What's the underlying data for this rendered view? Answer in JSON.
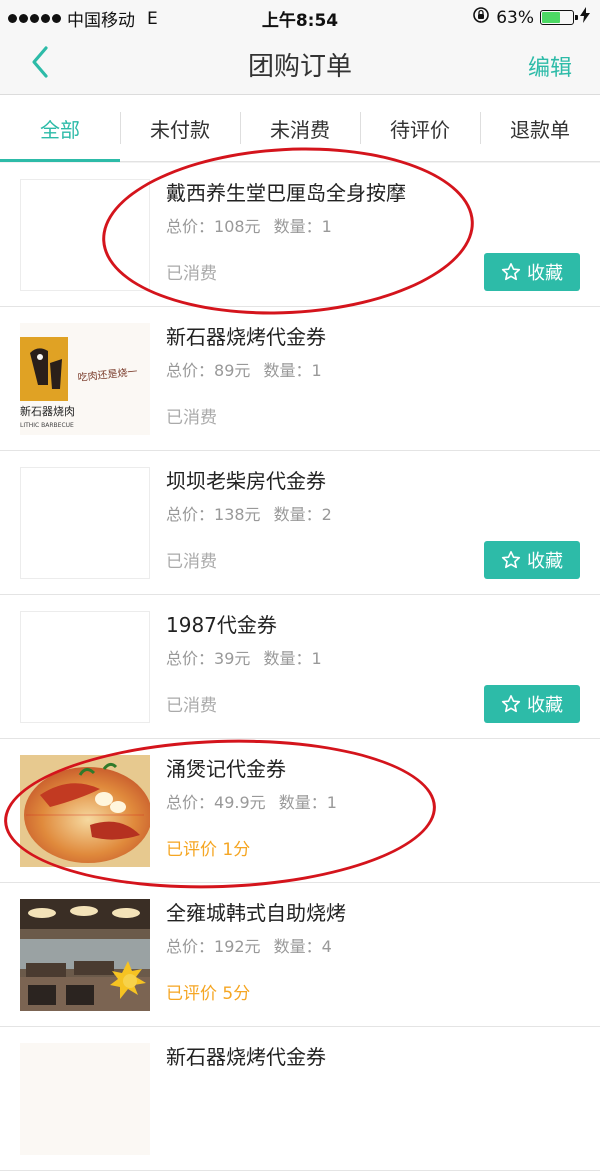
{
  "statusbar": {
    "carrier": "中国移动",
    "network": "E",
    "time": "上午8:54",
    "battery_text": "63%",
    "battery_level": 0.63
  },
  "nav": {
    "back_icon": "chevron-left-icon",
    "title": "团购订单",
    "edit_label": "编辑"
  },
  "tabs": [
    {
      "label": "全部",
      "active": true
    },
    {
      "label": "未付款",
      "active": false
    },
    {
      "label": "未消费",
      "active": false
    },
    {
      "label": "待评价",
      "active": false
    },
    {
      "label": "退款单",
      "active": false
    }
  ],
  "orders": [
    {
      "title": "戴西养生堂巴厘岛全身按摩",
      "price_label": "总价：",
      "price": "108元",
      "qty_label": "数量：",
      "qty": "1",
      "status": "已消费",
      "fav_label": "收藏",
      "thumb": "blank"
    },
    {
      "title": "新石器烧烤代金券",
      "price_label": "总价：",
      "price": "89元",
      "qty_label": "数量：",
      "qty": "1",
      "status": "已消费",
      "thumb": "logo",
      "logo_text": "新石器烧肉",
      "logo_subtext": "LITHIC BARBECUE",
      "slogan": "吃肉还是烧一"
    },
    {
      "title": "坝坝老柴房代金券",
      "price_label": "总价：",
      "price": "138元",
      "qty_label": "数量：",
      "qty": "2",
      "status": "已消费",
      "fav_label": "收藏",
      "thumb": "blank"
    },
    {
      "title": "1987代金券",
      "price_label": "总价：",
      "price": "39元",
      "qty_label": "数量：",
      "qty": "1",
      "status": "已消费",
      "fav_label": "收藏",
      "thumb": "blank"
    },
    {
      "title": "涌煲记代金券",
      "price_label": "总价：",
      "price": "49.9元",
      "qty_label": "数量：",
      "qty": "1",
      "status": "已评价 1分",
      "thumb": "food"
    },
    {
      "title": "全雍城韩式自助烧烤",
      "price_label": "总价：",
      "price": "192元",
      "qty_label": "数量：",
      "qty": "4",
      "status": "已评价 5分",
      "thumb": "restaurant"
    },
    {
      "title": "新石器烧烤代金券",
      "thumb": "logo"
    }
  ],
  "colors": {
    "accent": "#2dbba8",
    "rated": "#f5a623",
    "annotation": "#d4141c"
  }
}
